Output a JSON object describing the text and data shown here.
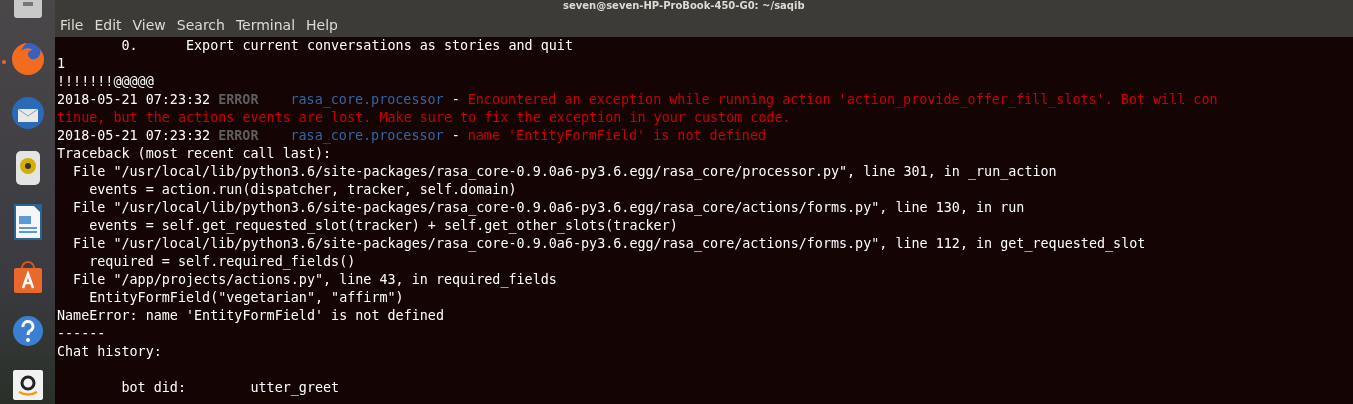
{
  "window": {
    "title": "seven@seven-HP-ProBook-450-G0: ~/saqib"
  },
  "dock": {
    "items": [
      {
        "kind": "files",
        "running": false
      },
      {
        "kind": "firefox",
        "running": true
      },
      {
        "kind": "mail",
        "running": false
      },
      {
        "kind": "speaker",
        "running": false
      },
      {
        "kind": "writer",
        "running": false
      },
      {
        "kind": "store",
        "running": false
      },
      {
        "kind": "help",
        "running": false
      },
      {
        "kind": "amazon",
        "running": false
      }
    ]
  },
  "menu": [
    "File",
    "Edit",
    "View",
    "Search",
    "Terminal",
    "Help"
  ],
  "terminal": {
    "lines": [
      [
        {
          "kind": "plain",
          "text": "        0.      Export current conversations as stories and quit"
        }
      ],
      [
        {
          "kind": "plain",
          "text": "1"
        }
      ],
      [
        {
          "kind": "plain",
          "text": "!!!!!!!@@@@@"
        }
      ],
      [
        {
          "kind": "plain",
          "text": "2018-05-21 07:23:32"
        },
        {
          "kind": "level",
          "text": "ERROR"
        },
        {
          "kind": "logger",
          "text": "rasa_core.processor"
        },
        {
          "kind": "plain",
          "text": "-"
        },
        {
          "kind": "error",
          "text": "Encountered an exception while running action 'action_provide_offer_fill_slots'. Bot will con"
        }
      ],
      [
        {
          "kind": "error",
          "text": "tinue, but the actions events are lost. Make sure to fix the exception in your custom code."
        }
      ],
      [
        {
          "kind": "plain",
          "text": "2018-05-21 07:23:32"
        },
        {
          "kind": "level",
          "text": "ERROR"
        },
        {
          "kind": "logger",
          "text": "rasa_core.processor"
        },
        {
          "kind": "plain",
          "text": "-"
        },
        {
          "kind": "error",
          "text": "name 'EntityFormField' is not defined"
        }
      ],
      [
        {
          "kind": "plain",
          "text": "Traceback (most recent call last):"
        }
      ],
      [
        {
          "kind": "plain",
          "text": "  File \"/usr/local/lib/python3.6/site-packages/rasa_core-0.9.0a6-py3.6.egg/rasa_core/processor.py\", line 301, in _run_action"
        }
      ],
      [
        {
          "kind": "plain",
          "text": "    events = action.run(dispatcher, tracker, self.domain)"
        }
      ],
      [
        {
          "kind": "plain",
          "text": "  File \"/usr/local/lib/python3.6/site-packages/rasa_core-0.9.0a6-py3.6.egg/rasa_core/actions/forms.py\", line 130, in run"
        }
      ],
      [
        {
          "kind": "plain",
          "text": "    events = self.get_requested_slot(tracker) + self.get_other_slots(tracker)"
        }
      ],
      [
        {
          "kind": "plain",
          "text": "  File \"/usr/local/lib/python3.6/site-packages/rasa_core-0.9.0a6-py3.6.egg/rasa_core/actions/forms.py\", line 112, in get_requested_slot"
        }
      ],
      [
        {
          "kind": "plain",
          "text": "    required = self.required_fields()"
        }
      ],
      [
        {
          "kind": "plain",
          "text": "  File \"/app/projects/actions.py\", line 43, in required_fields"
        }
      ],
      [
        {
          "kind": "plain",
          "text": "    EntityFormField(\"vegetarian\", \"affirm\")"
        }
      ],
      [
        {
          "kind": "plain",
          "text": "NameError: name 'EntityFormField' is not defined"
        }
      ],
      [
        {
          "kind": "plain",
          "text": "------"
        }
      ],
      [
        {
          "kind": "plain",
          "text": "Chat history:"
        }
      ],
      [
        {
          "kind": "plain",
          "text": "        bot did:        utter_greet"
        }
      ]
    ]
  }
}
